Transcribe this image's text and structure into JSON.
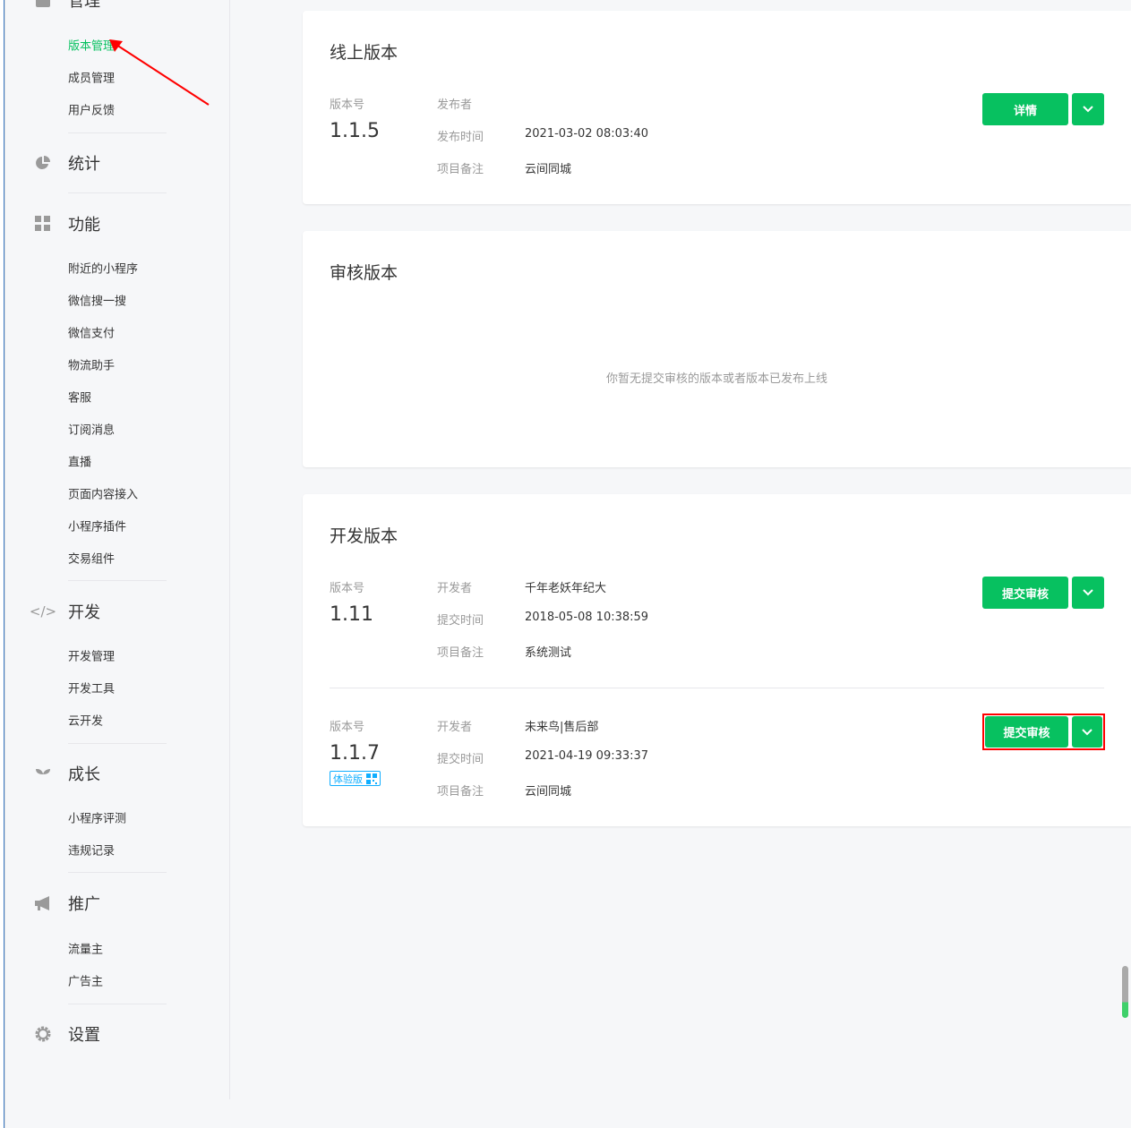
{
  "sidebar": {
    "groups": [
      {
        "label": "管理",
        "icon": "manage-icon",
        "items": [
          "版本管理",
          "成员管理",
          "用户反馈"
        ]
      },
      {
        "label": "统计",
        "icon": "pie-chart-icon",
        "items": []
      },
      {
        "label": "功能",
        "icon": "grid-icon",
        "items": [
          "附近的小程序",
          "微信搜一搜",
          "微信支付",
          "物流助手",
          "客服",
          "订阅消息",
          "直播",
          "页面内容接入",
          "小程序插件",
          "交易组件"
        ]
      },
      {
        "label": "开发",
        "icon": "code-icon",
        "items": [
          "开发管理",
          "开发工具",
          "云开发"
        ]
      },
      {
        "label": "成长",
        "icon": "sprout-icon",
        "items": [
          "小程序评测",
          "违规记录"
        ]
      },
      {
        "label": "推广",
        "icon": "megaphone-icon",
        "items": [
          "流量主",
          "广告主"
        ]
      },
      {
        "label": "设置",
        "icon": "gear-icon",
        "items": []
      }
    ]
  },
  "online": {
    "title": "线上版本",
    "version_label": "版本号",
    "version": "1.1.5",
    "publisher_label": "发布者",
    "time_label": "发布时间",
    "time": "2021-03-02 08:03:40",
    "note_label": "项目备注",
    "note": "云间同城",
    "detail_btn": "详情"
  },
  "review": {
    "title": "审核版本",
    "empty": "你暂无提交审核的版本或者版本已发布上线"
  },
  "dev": {
    "title": "开发版本",
    "rows": [
      {
        "version_label": "版本号",
        "version": "1.11",
        "dev_label": "开发者",
        "dev": "千年老妖年纪大",
        "time_label": "提交时间",
        "time": "2018-05-08 10:38:59",
        "note_label": "项目备注",
        "note": "系统测试",
        "btn": "提交审核"
      },
      {
        "version_label": "版本号",
        "version": "1.1.7",
        "tag": "体验版",
        "dev_label": "开发者",
        "dev": "未来鸟|售后部",
        "time_label": "提交时间",
        "time": "2021-04-19 09:33:37",
        "note_label": "项目备注",
        "note": "云间同城",
        "btn": "提交审核"
      }
    ]
  },
  "colors": {
    "accent": "#07c160",
    "annotation": "#ff0000"
  }
}
